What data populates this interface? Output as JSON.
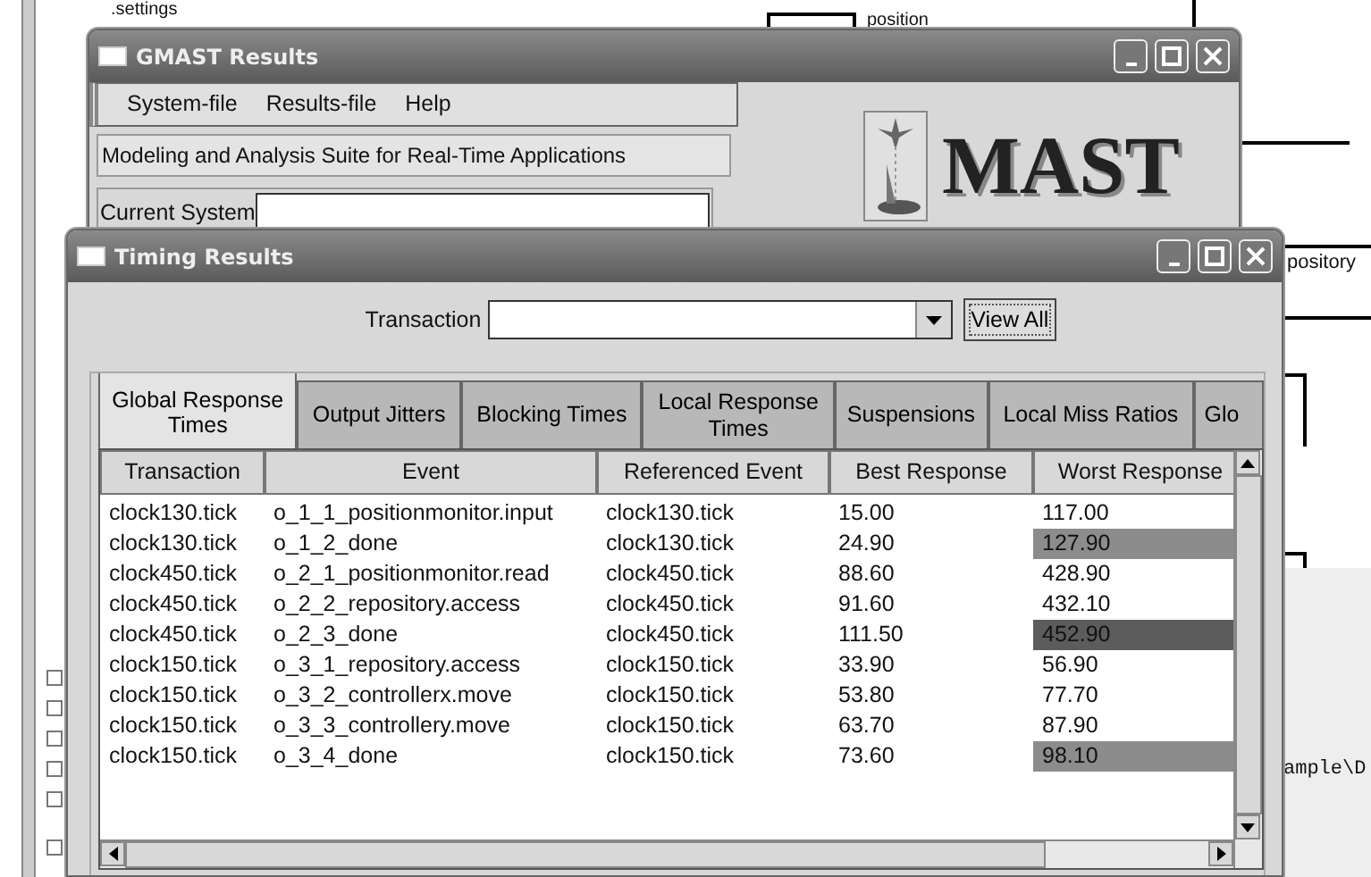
{
  "background": {
    "tree_item": ".settings",
    "diagram_labels": [
      "position",
      "pository"
    ],
    "editor_text": "ample\\D"
  },
  "gmast_window": {
    "title": "GMAST Results",
    "menu": [
      "System-file",
      "Results-file",
      "Help"
    ],
    "subtitle": "Modeling and Analysis Suite for Real-Time Applications",
    "current_system": {
      "label": "Current System"
    },
    "logo_text": "MAST"
  },
  "timing_window": {
    "title": "Timing Results",
    "transaction": {
      "label": "Transaction"
    },
    "view_all": "View All",
    "tabs": [
      {
        "label": "Global Response Times",
        "selected": true
      },
      {
        "label": "Output Jitters",
        "selected": false
      },
      {
        "label": "Blocking Times",
        "selected": false
      },
      {
        "label": "Local Response Times",
        "selected": false
      },
      {
        "label": "Suspensions",
        "selected": false
      },
      {
        "label": "Local Miss Ratios",
        "selected": false
      },
      {
        "label": "Glo",
        "selected": false
      }
    ],
    "table": {
      "columns": [
        "Transaction",
        "Event",
        "Referenced Event",
        "Best Response",
        "Worst Response"
      ],
      "rows": [
        {
          "cells": [
            "clock130.tick",
            "o_1_1_positionmonitor.input",
            "clock130.tick",
            "15.00",
            "117.00"
          ]
        },
        {
          "cells": [
            "clock130.tick",
            "o_1_2_done",
            "clock130.tick",
            "24.90",
            "127.90"
          ],
          "color": "#8c8c8c"
        },
        {
          "cells": [
            "clock450.tick",
            "o_2_1_positionmonitor.read",
            "clock450.tick",
            "88.60",
            "428.90"
          ]
        },
        {
          "cells": [
            "clock450.tick",
            "o_2_2_repository.access",
            "clock450.tick",
            "91.60",
            "432.10"
          ]
        },
        {
          "cells": [
            "clock450.tick",
            "o_2_3_done",
            "clock450.tick",
            "111.50",
            "452.90"
          ],
          "color": "#5c5c5c"
        },
        {
          "cells": [
            "clock150.tick",
            "o_3_1_repository.access",
            "clock150.tick",
            "33.90",
            "56.90"
          ]
        },
        {
          "cells": [
            "clock150.tick",
            "o_3_2_controllerx.move",
            "clock150.tick",
            "53.80",
            "77.70"
          ]
        },
        {
          "cells": [
            "clock150.tick",
            "o_3_3_controllery.move",
            "clock150.tick",
            "63.70",
            "87.90"
          ]
        },
        {
          "cells": [
            "clock150.tick",
            "o_3_4_done",
            "clock150.tick",
            "73.60",
            "98.10"
          ],
          "color": "#8c8c8c"
        }
      ]
    }
  }
}
